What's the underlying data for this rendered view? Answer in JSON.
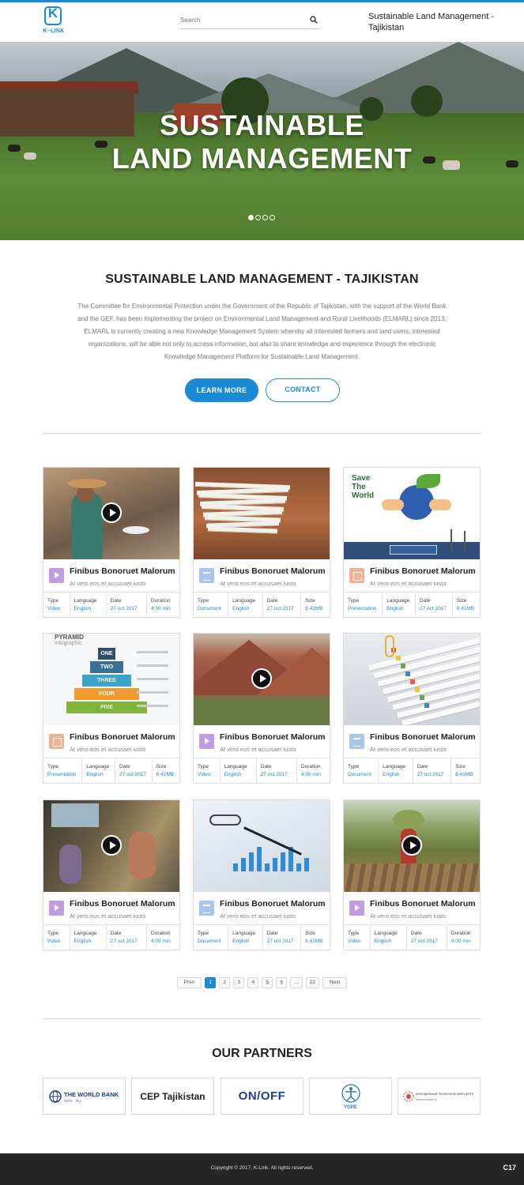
{
  "header": {
    "logo_text": "K~LINK",
    "search_placeholder": "Search",
    "site_title": "Sustainable Land Management - Tajikistan"
  },
  "hero": {
    "title_line1": "SUSTAINABLE",
    "title_line2": "LAND MANAGEMENT",
    "slide_count": 4,
    "active_slide": 1
  },
  "intro": {
    "title": "SUSTAINABLE LAND MANAGEMENT - TAJIKISTAN",
    "text": "The Committee for Environmental Protection under the Government of the Republic of Tajikistan, with the support of the World Bank and the GEF, has been implementing the project on Environmental Land Management and Rural Livelihoods (ELMARL) since 2013. ELMARL is currently creating a new Knowledge Management System whereby all interested farmers and land users, interested organizations, will be able not only to access information, but also to share knowledge and experience through the electronic Knowledge Management Platform for Sustainable Land Management.",
    "learn_more_label": "LEARN MORE",
    "contact_label": "CONTACT"
  },
  "cards": [
    {
      "title": "Finibus Bonoruet Malorum",
      "subtitle": "At vero eos et accusaet iusto",
      "icon": "video-icon",
      "media": "video",
      "meta": [
        {
          "label": "Type",
          "value": "Video"
        },
        {
          "label": "Language",
          "value": "English"
        },
        {
          "label": "Date",
          "value": "27 oct 2017"
        },
        {
          "label": "Duration",
          "value": "4:00 min"
        }
      ]
    },
    {
      "title": "Finibus Bonoruet Malorum",
      "subtitle": "At vero eos et accusaet iusto",
      "icon": "document-icon",
      "media": "document",
      "meta": [
        {
          "label": "Type",
          "value": "Document"
        },
        {
          "label": "Language",
          "value": "English"
        },
        {
          "label": "Date",
          "value": "27 oct 2017"
        },
        {
          "label": "Size",
          "value": "8.41MB"
        }
      ]
    },
    {
      "title": "Finibus Bonoruet Malorum",
      "subtitle": "At vero eos et accusaet iusto",
      "icon": "presentation-icon",
      "media": "presentation",
      "meta": [
        {
          "label": "Type",
          "value": "Presentation"
        },
        {
          "label": "Language",
          "value": "English"
        },
        {
          "label": "Date",
          "value": "27 oct 2017"
        },
        {
          "label": "Size",
          "value": "8.41MB"
        }
      ]
    },
    {
      "title": "Finibus Bonoruet Malorum",
      "subtitle": "At vero eos et accusaet iusto",
      "icon": "presentation-icon",
      "media": "presentation",
      "meta": [
        {
          "label": "Type",
          "value": "Presentation"
        },
        {
          "label": "Language",
          "value": "English"
        },
        {
          "label": "Date",
          "value": "27 oct 2017"
        },
        {
          "label": "Size",
          "value": "8.41MB"
        }
      ]
    },
    {
      "title": "Finibus Bonoruet Malorum",
      "subtitle": "At vero eos et accusaet iusto",
      "icon": "video-icon",
      "media": "video",
      "meta": [
        {
          "label": "Type",
          "value": "Video"
        },
        {
          "label": "Language",
          "value": "English"
        },
        {
          "label": "Date",
          "value": "27 oct 2017"
        },
        {
          "label": "Duration",
          "value": "4:00 min"
        }
      ]
    },
    {
      "title": "Finibus Bonoruet Malorum",
      "subtitle": "At vero eos et accusaet iusto",
      "icon": "document-icon",
      "media": "document",
      "meta": [
        {
          "label": "Type",
          "value": "Document"
        },
        {
          "label": "Language",
          "value": "English"
        },
        {
          "label": "Date",
          "value": "27 oct 2017"
        },
        {
          "label": "Size",
          "value": "8.41MB"
        }
      ]
    },
    {
      "title": "Finibus Bonoruet Malorum",
      "subtitle": "At vero eos et accusaet iusto",
      "icon": "video-icon",
      "media": "video",
      "meta": [
        {
          "label": "Type",
          "value": "Video"
        },
        {
          "label": "Language",
          "value": "English"
        },
        {
          "label": "Date",
          "value": "27 oct 2017"
        },
        {
          "label": "Duration",
          "value": "4:00 min"
        }
      ]
    },
    {
      "title": "Finibus Bonoruet Malorum",
      "subtitle": "At vero eos et accusaet iusto",
      "icon": "document-icon",
      "media": "document",
      "meta": [
        {
          "label": "Type",
          "value": "Document"
        },
        {
          "label": "Language",
          "value": "English"
        },
        {
          "label": "Date",
          "value": "27 oct 2017"
        },
        {
          "label": "Size",
          "value": "8.41MB"
        }
      ]
    },
    {
      "title": "Finibus Bonoruet Malorum",
      "subtitle": "At vero eos et accusaet iusto",
      "icon": "video-icon",
      "media": "video",
      "meta": [
        {
          "label": "Type",
          "value": "Video"
        },
        {
          "label": "Language",
          "value": "English"
        },
        {
          "label": "Date",
          "value": "27 oct 2017"
        },
        {
          "label": "Duration",
          "value": "4:00 min"
        }
      ]
    }
  ],
  "card_images": {
    "save_the_world_text": "Save The World",
    "pyramid_title": "PYRAMID",
    "pyramid_subtitle": "Infographic",
    "pyramid_levels": [
      "ONE",
      "TWO",
      "THREE",
      "FOUR",
      "FIVE"
    ]
  },
  "pagination": {
    "prev_label": "Prev",
    "pages": [
      "1",
      "2",
      "3",
      "4",
      "5",
      "6",
      "...",
      "22"
    ],
    "active_page": "1",
    "next_label": "Next"
  },
  "partners": {
    "title": "OUR PARTNERS",
    "items": [
      {
        "name": "THE WORLD BANK",
        "sub": "IBRD · IDA"
      },
      {
        "name": "CEP Tajikistan",
        "sub": ""
      },
      {
        "name": "ON/OFF",
        "sub": ""
      },
      {
        "name": "YGPE",
        "sub": ""
      },
      {
        "name": "МОЛОДЁЖНЫЙ ЭКОЛОГИЧЕСКИЙ ЦЕНТР",
        "sub": "www.ecocentre.tj"
      }
    ]
  },
  "footer": {
    "copyright": "Copyright © 2017, K-Link. All rights reserved.",
    "badge": "C17"
  },
  "colors": {
    "accent": "#1a8ad6",
    "footer_bg": "#262626",
    "video_icon": "#c39be0",
    "document_icon": "#a8c6ec",
    "presentation_icon": "#f2b095"
  }
}
